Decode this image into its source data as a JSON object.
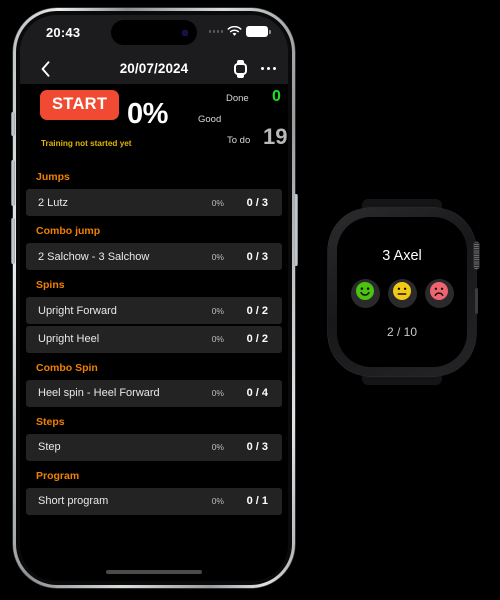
{
  "phone": {
    "status_bar": {
      "time": "20:43",
      "signal_icon": "signal-dots-icon",
      "wifi_icon": "wifi-icon",
      "battery_icon": "battery-full-icon"
    },
    "nav": {
      "back_icon": "chevron-left-icon",
      "title": "20/07/2024",
      "watch_icon": "apple-watch-icon",
      "more_icon": "more-horizontal-icon"
    },
    "summary": {
      "start_label": "START",
      "percent": "0%",
      "status_note": "Training not started yet",
      "done_label": "Done",
      "done_value": "0",
      "good_label": "Good",
      "todo_label": "To do",
      "todo_value": "19"
    },
    "sections": [
      {
        "title": "Jumps",
        "rows": [
          {
            "name": "2 Lutz",
            "percent": "0%",
            "count": "0 / 3"
          }
        ]
      },
      {
        "title": "Combo jump",
        "rows": [
          {
            "name": "2 Salchow - 3 Salchow",
            "percent": "0%",
            "count": "0 / 3"
          }
        ]
      },
      {
        "title": "Spins",
        "rows": [
          {
            "name": "Upright Forward",
            "percent": "0%",
            "count": "0 / 2"
          },
          {
            "name": "Upright Heel",
            "percent": "0%",
            "count": "0 / 2"
          }
        ]
      },
      {
        "title": "Combo Spin",
        "rows": [
          {
            "name": "Heel spin - Heel Forward",
            "percent": "0%",
            "count": "0 / 4"
          }
        ]
      },
      {
        "title": "Steps",
        "rows": [
          {
            "name": "Step",
            "percent": "0%",
            "count": "0 / 3"
          }
        ]
      },
      {
        "title": "Program",
        "rows": [
          {
            "name": "Short program",
            "percent": "0%",
            "count": "0 / 1"
          }
        ]
      }
    ]
  },
  "watch": {
    "element_title": "3 Axel",
    "rating_buttons": [
      {
        "icon": "smiley-happy-icon",
        "color": "#4CC211"
      },
      {
        "icon": "smiley-neutral-icon",
        "color": "#F2CA16"
      },
      {
        "icon": "smiley-sad-icon",
        "color": "#F06470"
      }
    ],
    "progress": "2 / 10"
  },
  "colors": {
    "accent_orange": "#f08000",
    "start_red": "#f04a32",
    "done_green": "#1ee01e",
    "note_yellow": "#e0b500",
    "row_bg": "#232323",
    "bar_bg": "#1c1c1e"
  }
}
